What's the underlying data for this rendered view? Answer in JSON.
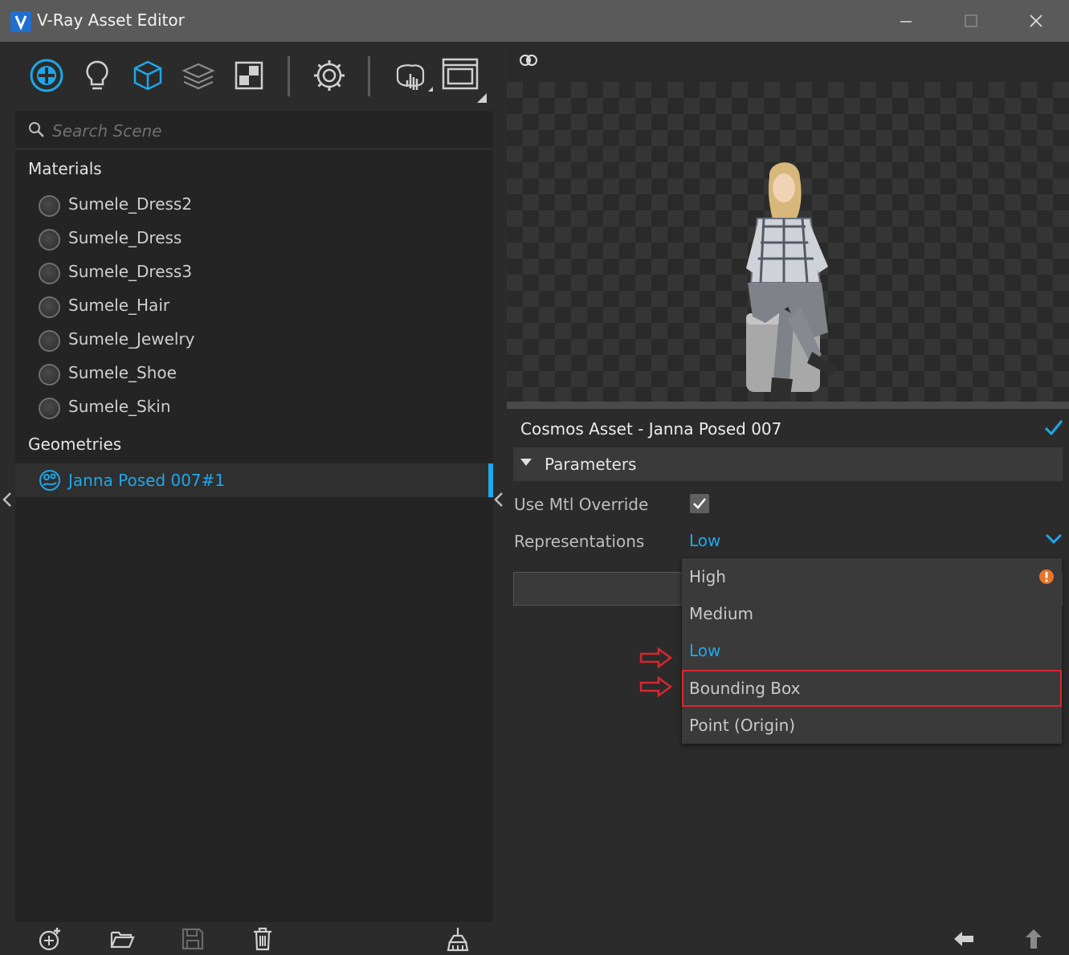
{
  "window": {
    "title": "V-Ray Asset Editor",
    "logo_color": "#1f6fd1"
  },
  "toolbar": {
    "icons": [
      "materials-icon",
      "lights-icon",
      "geometry-icon",
      "layers-icon",
      "textures-icon",
      "settings-icon",
      "render-interactive-icon",
      "render-window-icon"
    ]
  },
  "scene": {
    "search_placeholder": "Search Scene",
    "materials_title": "Materials",
    "materials": [
      "Sumele_Dress2",
      "Sumele_Dress",
      "Sumele_Dress3",
      "Sumele_Hair",
      "Sumele_Jewelry",
      "Sumele_Shoe",
      "Sumele_Skin"
    ],
    "geometries_title": "Geometries",
    "geometry_selected": "Janna Posed 007#1"
  },
  "properties": {
    "asset_title": "Cosmos Asset - Janna Posed 007",
    "section": "Parameters",
    "use_mtl_override_label": "Use Mtl Override",
    "use_mtl_override_checked": true,
    "representations_label": "Representations",
    "representations_value": "Low"
  },
  "dropdown": {
    "options": [
      "High",
      "Medium",
      "Low",
      "Bounding Box",
      "Point (Origin)"
    ],
    "selected": "Low",
    "highlighted": "Bounding Box",
    "warning_on": "High"
  },
  "colors": {
    "accent": "#1ea7ea",
    "highlight_border": "#d7272f",
    "warning": "#e8762b"
  },
  "bottom_bar": {
    "icons": [
      "add-material-icon",
      "open-folder-icon",
      "save-icon",
      "delete-icon",
      "purge-icon",
      "back-arrow-icon",
      "up-arrow-icon"
    ]
  }
}
